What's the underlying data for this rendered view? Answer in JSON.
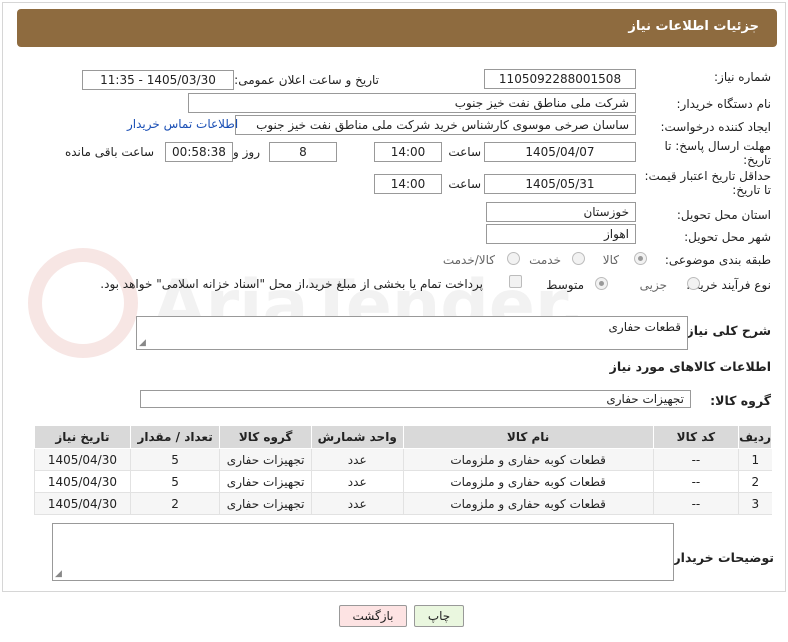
{
  "header": {
    "title": "جزئیات اطلاعات نیاز"
  },
  "form": {
    "need_number_label": "شماره نیاز:",
    "need_number": "1105092288001508",
    "announce_label": "تاریخ و ساعت اعلان عمومی:",
    "announce_value": "1405/03/30 - 11:35",
    "buyer_org_label": "نام دستگاه خریدار:",
    "buyer_org": "شرکت ملی مناطق نفت خیز جنوب",
    "creator_label": "ایجاد کننده درخواست:",
    "creator": "ساسان صرخی موسوی کارشناس خرید  شرکت ملی مناطق نفت خیز جنوب",
    "contact_link": "اطلاعات تماس خریدار",
    "deadline_label_1": "مهلت ارسال پاسخ: تا",
    "deadline_label_2": "تاریخ:",
    "deadline_date": "1405/04/07",
    "time_word": "ساعت",
    "deadline_time": "14:00",
    "days_count": "8",
    "days_word": "روز و",
    "remaining_time": "00:58:38",
    "remaining_word": "ساعت باقی مانده",
    "validity_label_1": "حداقل تاریخ اعتبار قیمت:",
    "validity_label_2": "تا تاریخ:",
    "validity_date": "1405/05/31",
    "validity_time": "14:00",
    "province_label": "استان محل تحویل:",
    "province": "خوزستان",
    "city_label": "شهر محل تحویل:",
    "city": "اهواز",
    "category_label": "طبقه بندی موضوعی:",
    "category_options": [
      "کالا",
      "خدمت",
      "کالا/خدمت"
    ],
    "category_selected": "کالا",
    "process_label": "نوع فرآیند خرید :",
    "process_options": [
      "جزیی",
      "متوسط"
    ],
    "process_selected": "متوسط",
    "payment_text": "پرداخت تمام یا بخشی از مبلغ خرید،از محل \"اسناد خزانه اسلامی\" خواهد بود."
  },
  "description": {
    "label": "شرح کلی نیاز:",
    "value": "قطعات حفاری"
  },
  "goods": {
    "section_title": "اطلاعات کالاهای مورد نیاز",
    "group_label": "گروه کالا:",
    "group_value": "تجهیزات حفاری",
    "columns": [
      "ردیف",
      "کد کالا",
      "نام کالا",
      "واحد شمارش",
      "گروه کالا",
      "تعداد / مقدار",
      "تاریخ نیاز"
    ],
    "rows": [
      [
        "1",
        "--",
        "قطعات کوبه حفاری و ملزومات",
        "عدد",
        "تجهیزات حفاری",
        "5",
        "1405/04/30"
      ],
      [
        "2",
        "--",
        "قطعات کوبه حفاری و ملزومات",
        "عدد",
        "تجهیزات حفاری",
        "5",
        "1405/04/30"
      ],
      [
        "3",
        "--",
        "قطعات کوبه حفاری و ملزومات",
        "عدد",
        "تجهیزات حفاری",
        "2",
        "1405/04/30"
      ]
    ]
  },
  "buyer_notes": {
    "label": "توضیحات خریدار:",
    "value": ""
  },
  "buttons": {
    "print": "چاپ",
    "back": "بازگشت"
  },
  "watermark": {
    "text": "AriaTender.neT"
  },
  "colors": {
    "header": "#8e6b3f",
    "link": "#1a4fb5",
    "print_bg": "#eaf7df",
    "back_bg": "#fde3e3"
  }
}
